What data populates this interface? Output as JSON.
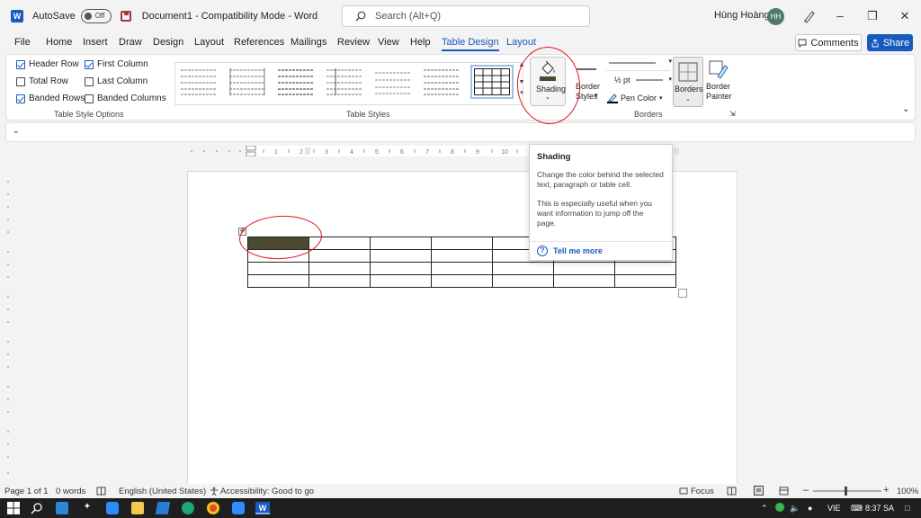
{
  "titlebar": {
    "autosave_label": "AutoSave",
    "autosave_state": "Off",
    "document_title": "Document1  -  Compatibility Mode  -  Word",
    "search_placeholder": "Search (Alt+Q)",
    "user_name": "Hùng Hoàng",
    "user_initials": "HH"
  },
  "menu": {
    "tabs": [
      "File",
      "Home",
      "Insert",
      "Draw",
      "Design",
      "Layout",
      "References",
      "Mailings",
      "Review",
      "View",
      "Help",
      "Table Design",
      "Layout"
    ],
    "active_tab": "Table Design",
    "comments_label": "Comments",
    "share_label": "Share"
  },
  "ribbon": {
    "style_options": {
      "header_row": {
        "label": "Header Row",
        "checked": true
      },
      "total_row": {
        "label": "Total Row",
        "checked": false
      },
      "banded_rows": {
        "label": "Banded Rows",
        "checked": true
      },
      "first_column": {
        "label": "First Column",
        "checked": true
      },
      "last_column": {
        "label": "Last Column",
        "checked": false
      },
      "banded_columns": {
        "label": "Banded Columns",
        "checked": false
      },
      "group_label": "Table Style Options"
    },
    "table_styles_label": "Table Styles",
    "shading_label": "Shading",
    "border_styles_line1": "Border",
    "border_styles_line2": "Styles",
    "pen_weight": "½ pt",
    "pen_color_label": "Pen Color",
    "borders_label": "Borders",
    "border_painter_line1": "Border",
    "border_painter_line2": "Painter",
    "borders_group_label": "Borders",
    "shading_color": "#4e4a31"
  },
  "tooltip": {
    "title": "Shading",
    "body1": "Change the color behind the selected text, paragraph or table cell.",
    "body2": "This is especially useful when you want information to jump off the page.",
    "link": "Tell me more"
  },
  "statusbar": {
    "page": "Page 1 of 1",
    "words": "0 words",
    "language": "English (United States)",
    "accessibility": "Accessibility: Good to go",
    "focus": "Focus",
    "zoom": "100%"
  },
  "taskbar": {
    "language": "VIE",
    "time": "8:37 SA"
  },
  "ruler_numbers": [
    "1",
    "2",
    "3",
    "4",
    "5",
    "6",
    "7",
    "8",
    "9",
    "10"
  ],
  "annotation_color": "#e0141e"
}
